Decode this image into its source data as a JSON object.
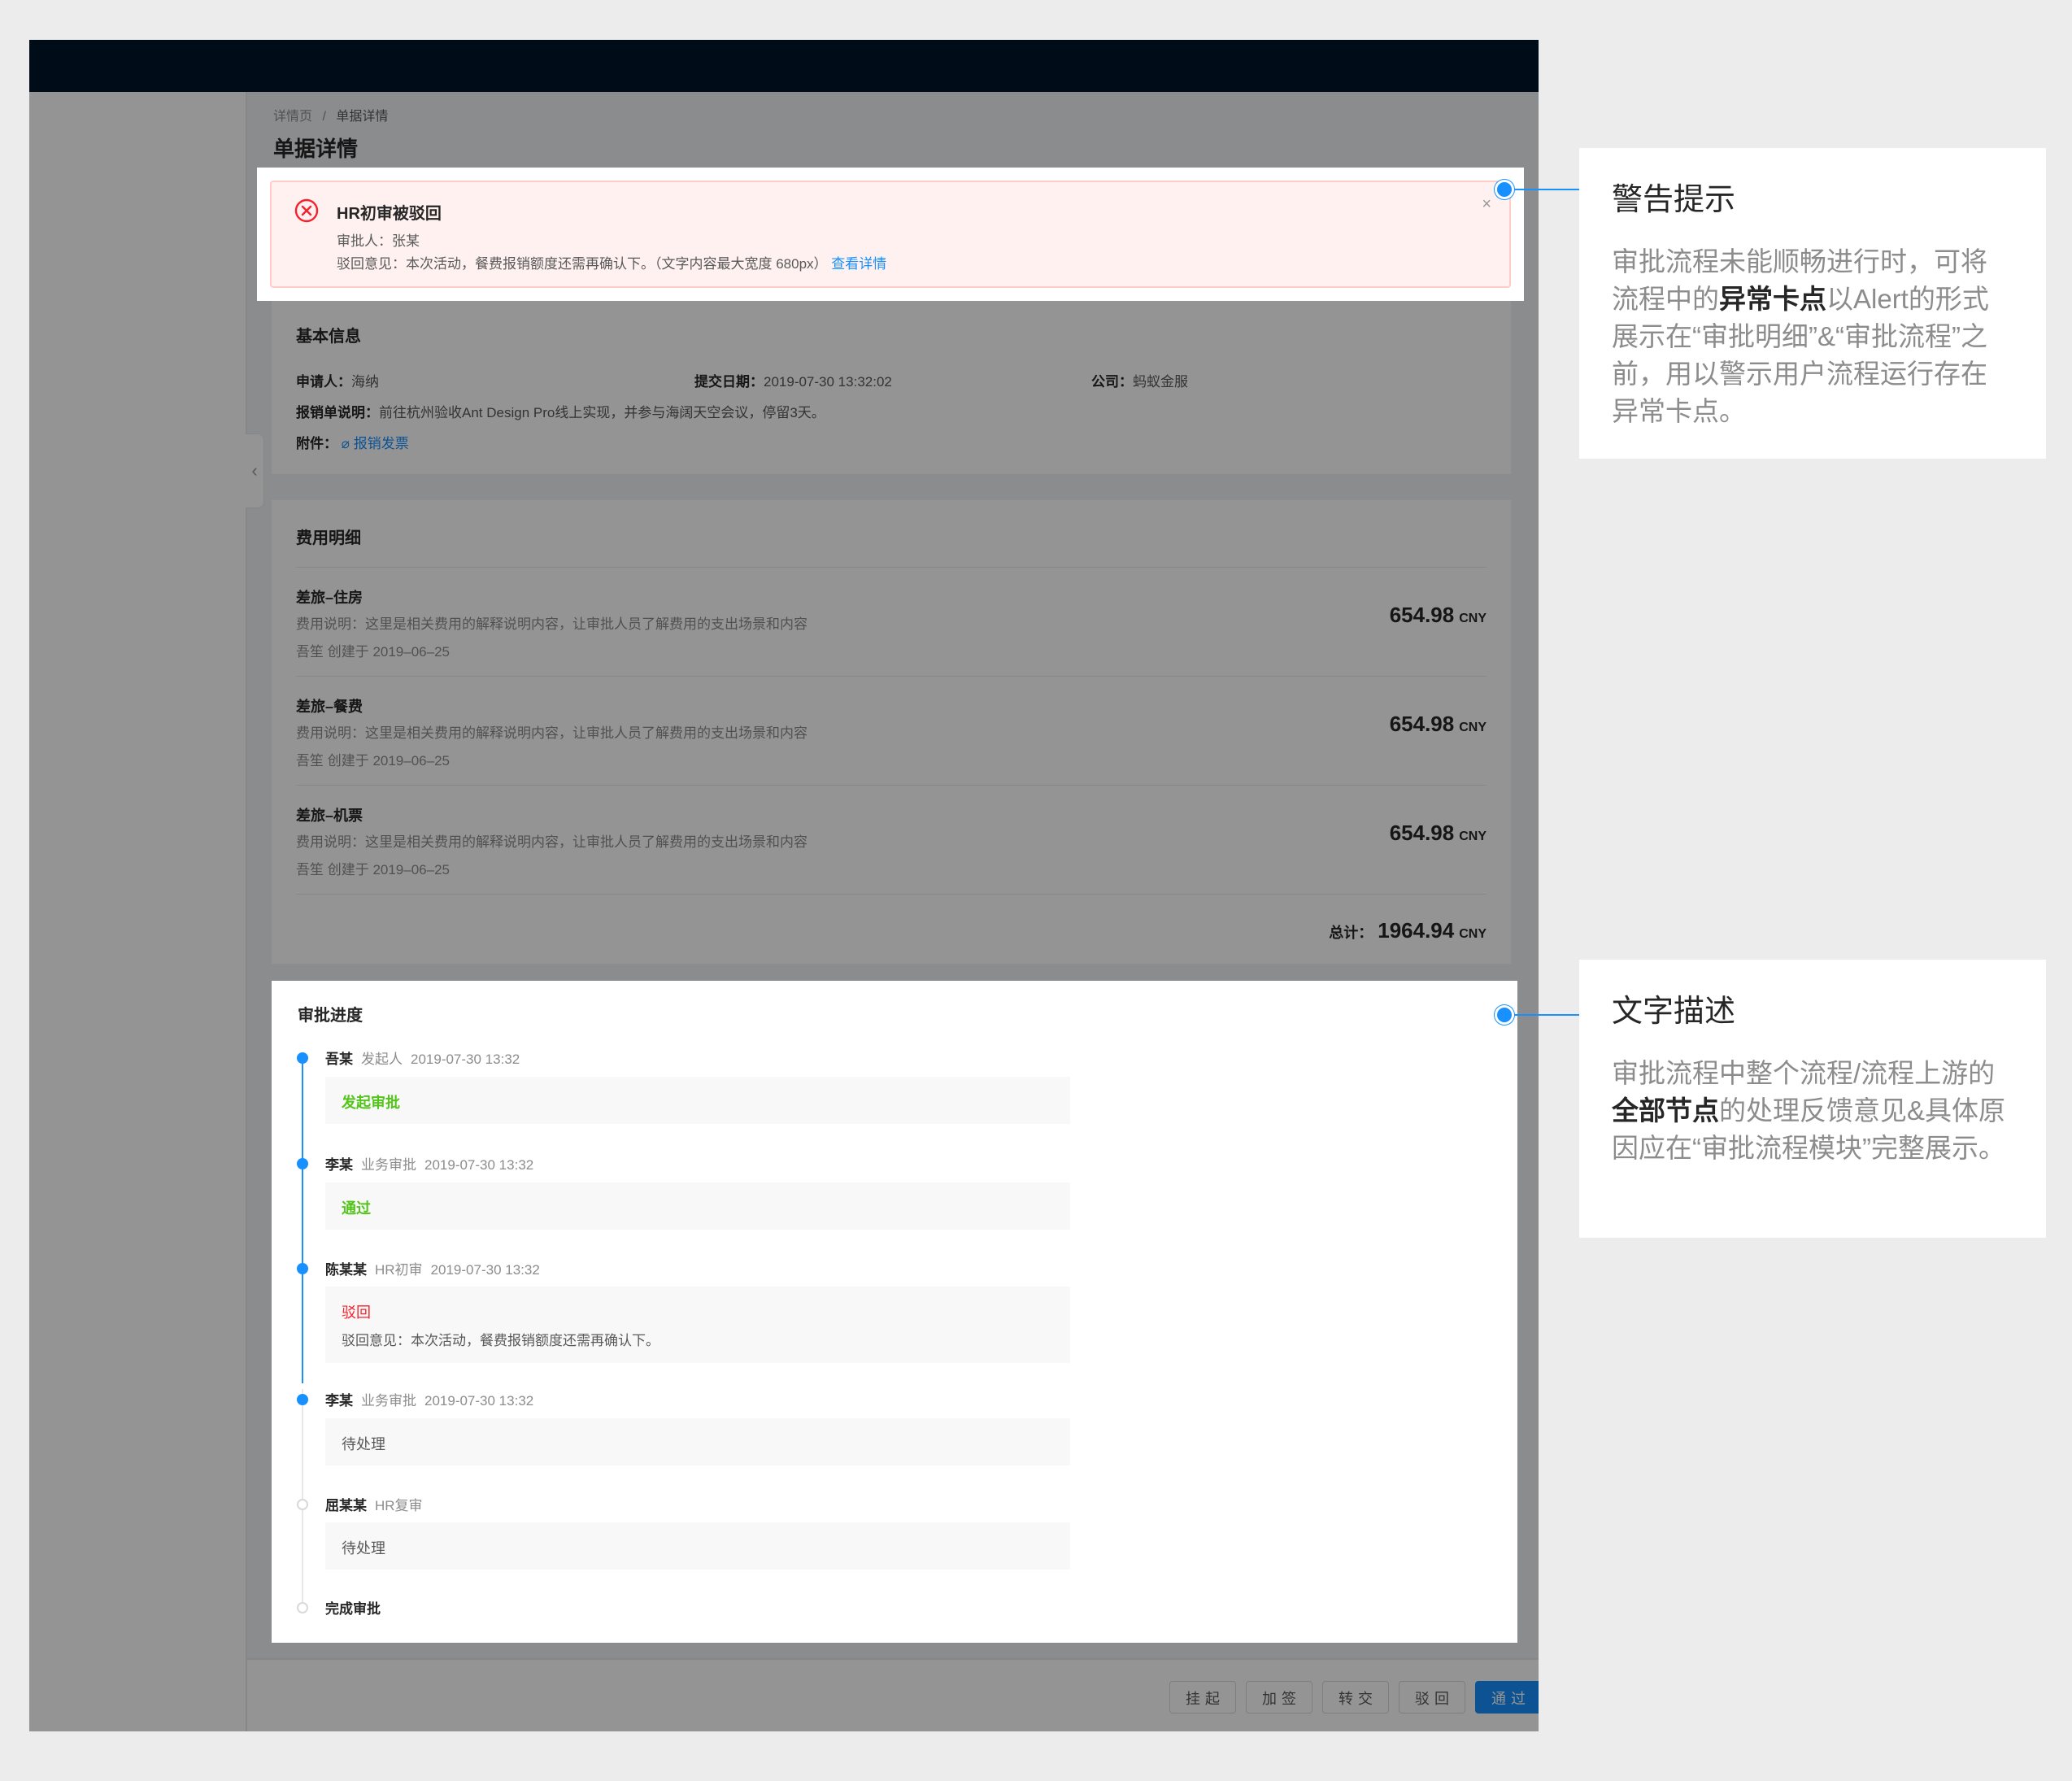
{
  "breadcrumb": {
    "parent": "详情页",
    "separator": "/",
    "current": "单据详情"
  },
  "page_title": "单据详情",
  "alert": {
    "title": "HR初审被驳回",
    "approver": "审批人：张某",
    "reason": "驳回意见：本次活动，餐费报销额度还需再确认下。（文字内容最大宽度 680px）",
    "detail_link": "查看详情",
    "close": "×",
    "color": "#f5222d"
  },
  "basic": {
    "title": "基本信息",
    "applicant_label": "申请人：",
    "applicant": "海纳",
    "date_label": "提交日期：",
    "date": "2019-07-30 13:32:02",
    "company_label": "公司：",
    "company": "蚂蚁金服",
    "desc_label": "报销单说明：",
    "desc": "前往杭州验收Ant Design Pro线上实现，并参与海阔天空会议，停留3天。",
    "attach_label": "附件：",
    "attach_icon": "paperclip-icon",
    "attach": "报销发票"
  },
  "fees": {
    "title": "费用明细",
    "items": [
      {
        "name": "差旅–住房",
        "desc": "费用说明：这里是相关费用的解释说明内容，让审批人员了解费用的支出场景和内容",
        "meta": "吾笙 创建于 2019–06–25",
        "amount": "654.98",
        "unit": "CNY"
      },
      {
        "name": "差旅–餐费",
        "desc": "费用说明：这里是相关费用的解释说明内容，让审批人员了解费用的支出场景和内容",
        "meta": "吾笙 创建于 2019–06–25",
        "amount": "654.98",
        "unit": "CNY"
      },
      {
        "name": "差旅–机票",
        "desc": "费用说明：这里是相关费用的解释说明内容，让审批人员了解费用的支出场景和内容",
        "meta": "吾笙 创建于 2019–06–25",
        "amount": "654.98",
        "unit": "CNY"
      }
    ],
    "total_label": "总计：",
    "total": "1964.94",
    "total_unit": "CNY"
  },
  "approval": {
    "title": "审批进度",
    "colors": {
      "active": "#1890ff",
      "pass": "#52c41a",
      "reject": "#f5222d",
      "pending": "#d9d9d9"
    },
    "nodes": [
      {
        "name": "吾某",
        "role": "发起人",
        "time": "2019-07-30 13:32",
        "status": "发起审批",
        "note": ""
      },
      {
        "name": "李某",
        "role": "业务审批",
        "time": "2019-07-30 13:32",
        "status": "通过",
        "note": ""
      },
      {
        "name": "陈某某",
        "role": "HR初审",
        "time": "2019-07-30 13:32",
        "status": "驳回",
        "note": "驳回意见：本次活动，餐费报销额度还需再确认下。"
      },
      {
        "name": "李某",
        "role": "业务审批",
        "time": "2019-07-30 13:32",
        "status": "待处理",
        "note": ""
      },
      {
        "name": "屈某某",
        "role": "HR复审",
        "time": "",
        "status": "待处理",
        "note": ""
      },
      {
        "name": "完成审批",
        "role": "",
        "time": "",
        "status": "",
        "note": ""
      }
    ]
  },
  "footer": {
    "buttons": [
      "挂起",
      "加签",
      "转交",
      "驳回",
      "通过"
    ]
  },
  "annotations": {
    "alert": {
      "title": "警告提示",
      "text_1": "审批流程未能顺畅进行时，可将流程中的",
      "bold": "异常卡点",
      "text_2": "以Alert的形式展示在“审批明细”&“审批流程”之前，用以警示用户流程运行存在异常卡点。"
    },
    "text": {
      "title": "文字描述",
      "text_1": "审批流程中整个流程/流程上游的",
      "bold": "全部节点",
      "text_2": "的处理反馈意见&具体原因应在“审批流程模块”完整展示。"
    }
  }
}
